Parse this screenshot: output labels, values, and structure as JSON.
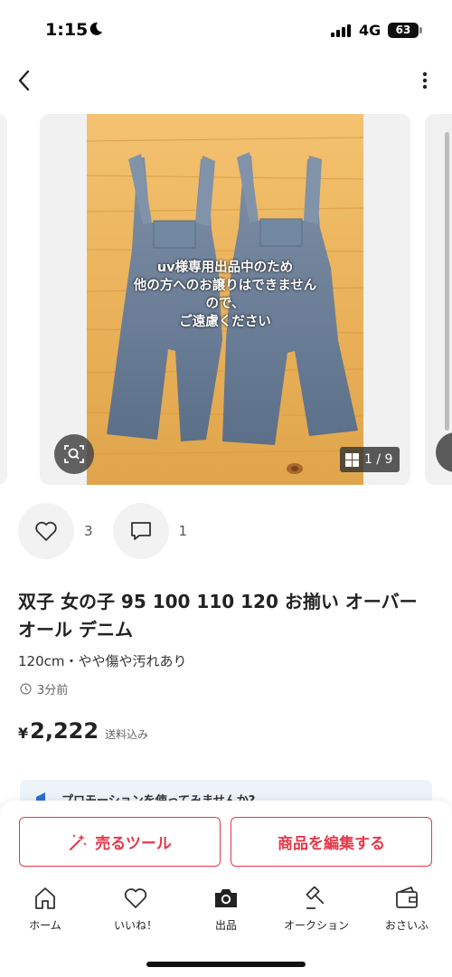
{
  "status_bar": {
    "time": "1:15",
    "network": "4G",
    "battery": "63"
  },
  "gallery": {
    "overlay_lines": [
      "uv様専用出品中のため",
      "他の方へのお譲りはできません",
      "ので、",
      "ご遠慮ください"
    ],
    "counter": "1 / 9"
  },
  "actions": {
    "likes": "3",
    "comments": "1"
  },
  "item": {
    "title": "双子 女の子 95 100 110 120 お揃い オーバーオール デニム",
    "subtitle": "120cm・やや傷や汚れあり",
    "posted": "3分前",
    "currency": "¥",
    "price": "2,222",
    "shipping": "送料込み"
  },
  "promo": {
    "text": "プロモーションを使ってみませんか?"
  },
  "buttons": {
    "sell_tool": "売るツール",
    "edit_item": "商品を編集する"
  },
  "tabbar": {
    "items": [
      {
        "label": "ホーム",
        "icon": "home-icon"
      },
      {
        "label": "いいね！",
        "icon": "heart-icon"
      },
      {
        "label": "出品",
        "icon": "camera-icon"
      },
      {
        "label": "オークション",
        "icon": "gavel-icon"
      },
      {
        "label": "おさいふ",
        "icon": "wallet-icon"
      }
    ]
  },
  "colors": {
    "accent": "#e5384a",
    "promo_bg": "#edf3f9"
  }
}
